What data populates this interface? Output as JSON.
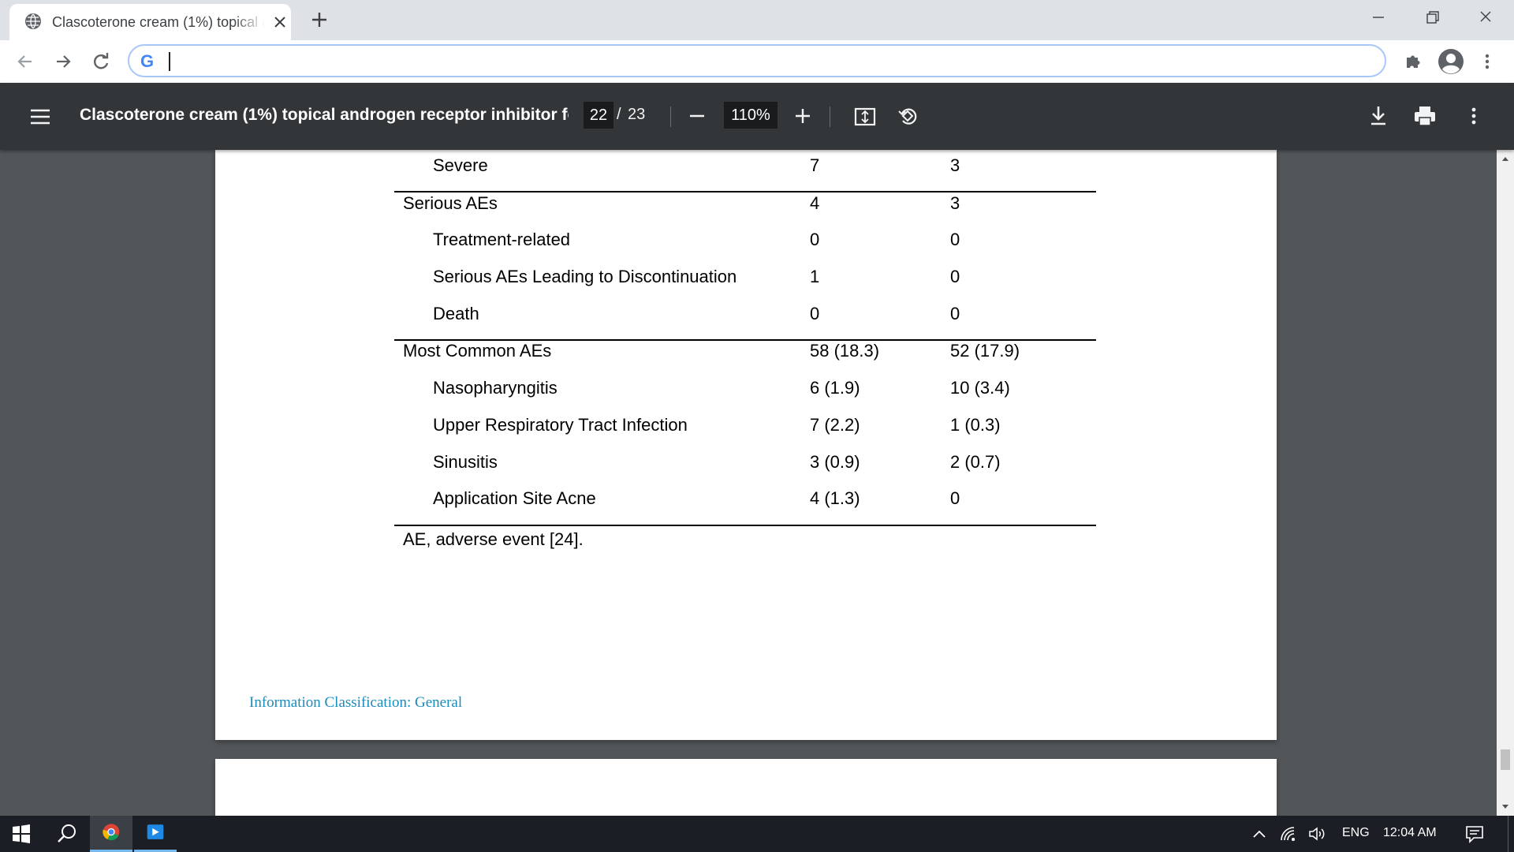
{
  "browser": {
    "tab_title": "Clascoterone cream (1%) topical androgen receptor inhibitor for...",
    "omnibox_value": "",
    "omnibox_logo": "G",
    "icons": {
      "tab": "globe-icon",
      "close": "close-icon",
      "new_tab": "plus-icon",
      "back": "arrow-left-icon",
      "forward": "arrow-right-icon",
      "reload": "reload-icon",
      "extensions": "puzzle-icon",
      "profile": "account-circle-icon",
      "menu": "kebab-menu-icon"
    }
  },
  "pdf_toolbar": {
    "title": "Clascoterone cream (1%) topical androgen receptor inhibitor for...",
    "page_current": "22",
    "page_separator": "/",
    "page_total": "23",
    "zoom": "110%",
    "icons": [
      "hamburger-menu-icon",
      "zoom-out-icon",
      "zoom-in-icon",
      "fit-to-page-icon",
      "rotate-icon",
      "download-icon",
      "print-icon",
      "kebab-menu-icon"
    ]
  },
  "document": {
    "rows": [
      {
        "label": "Severe",
        "c1": "7",
        "c2": "3",
        "indent": true
      },
      {
        "label": "Serious AEs",
        "c1": "4",
        "c2": "3",
        "indent": false
      },
      {
        "label": "Treatment-related",
        "c1": "0",
        "c2": "0",
        "indent": true
      },
      {
        "label": "Serious AEs Leading to Discontinuation",
        "c1": "1",
        "c2": "0",
        "indent": true
      },
      {
        "label": "Death",
        "c1": "0",
        "c2": "0",
        "indent": true
      },
      {
        "label": "Most Common AEs",
        "c1": "58 (18.3)",
        "c2": "52 (17.9)",
        "indent": false
      },
      {
        "label": "Nasopharyngitis",
        "c1": "6 (1.9)",
        "c2": "10 (3.4)",
        "indent": true
      },
      {
        "label": "Upper Respiratory Tract Infection",
        "c1": "7 (2.2)",
        "c2": "1 (0.3)",
        "indent": true
      },
      {
        "label": "Sinusitis",
        "c1": "3 (0.9)",
        "c2": "2 (0.7)",
        "indent": true
      },
      {
        "label": "Application Site Acne",
        "c1": "4 (1.3)",
        "c2": "0",
        "indent": true
      }
    ],
    "footnote": "AE, adverse event [24].",
    "classification": "Information Classification: General"
  },
  "taskbar": {
    "language": "ENG",
    "clock": "12:04 AM",
    "apps": [
      "windows-start-icon",
      "search-icon",
      "chrome-icon",
      "media-player-icon"
    ],
    "tray": [
      "chevron-up-icon",
      "wifi-icon",
      "volume-icon",
      "notification-icon"
    ]
  },
  "colors": {
    "pdf_toolbar": "#323639",
    "viewer_bg": "#525659",
    "classification_text": "#1a8bbd",
    "taskbar": "#1b1e24"
  }
}
